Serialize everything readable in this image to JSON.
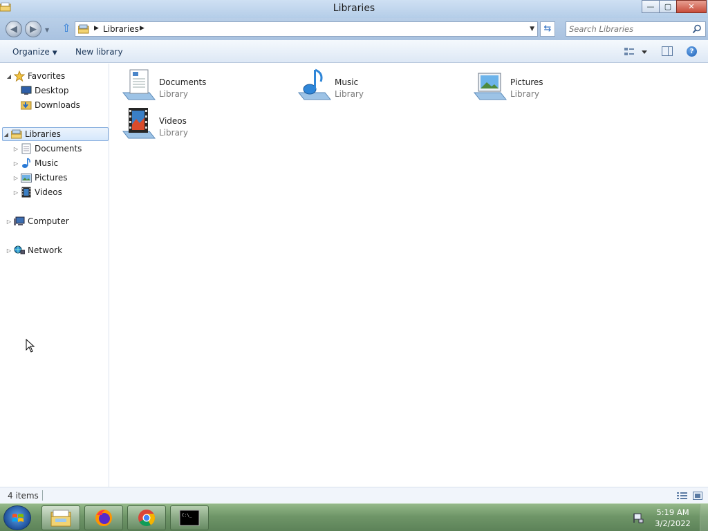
{
  "window": {
    "title": "Libraries"
  },
  "title_buttons": {
    "minimize": "—",
    "maximize": "▢",
    "close": "✕"
  },
  "address": {
    "breadcrumb": "Libraries"
  },
  "search": {
    "placeholder": "Search Libraries"
  },
  "commandbar": {
    "organize": "Organize",
    "new_library": "New library",
    "help": "?"
  },
  "navpane": {
    "favorites": {
      "label": "Favorites",
      "items": [
        "Desktop",
        "Downloads"
      ]
    },
    "libraries": {
      "label": "Libraries",
      "items": [
        "Documents",
        "Music",
        "Pictures",
        "Videos"
      ]
    },
    "computer": "Computer",
    "network": "Network"
  },
  "libraries": [
    {
      "name": "Documents",
      "type": "Library"
    },
    {
      "name": "Music",
      "type": "Library"
    },
    {
      "name": "Pictures",
      "type": "Library"
    },
    {
      "name": "Videos",
      "type": "Library"
    }
  ],
  "status": {
    "item_count": "4 items"
  },
  "taskbar": {
    "apps": [
      "Windows Explorer",
      "Firefox",
      "Chrome",
      "Command Prompt"
    ],
    "cmd_label": "C:\\_"
  },
  "clock": {
    "time": "5:19 AM",
    "date": "3/2/2022"
  }
}
